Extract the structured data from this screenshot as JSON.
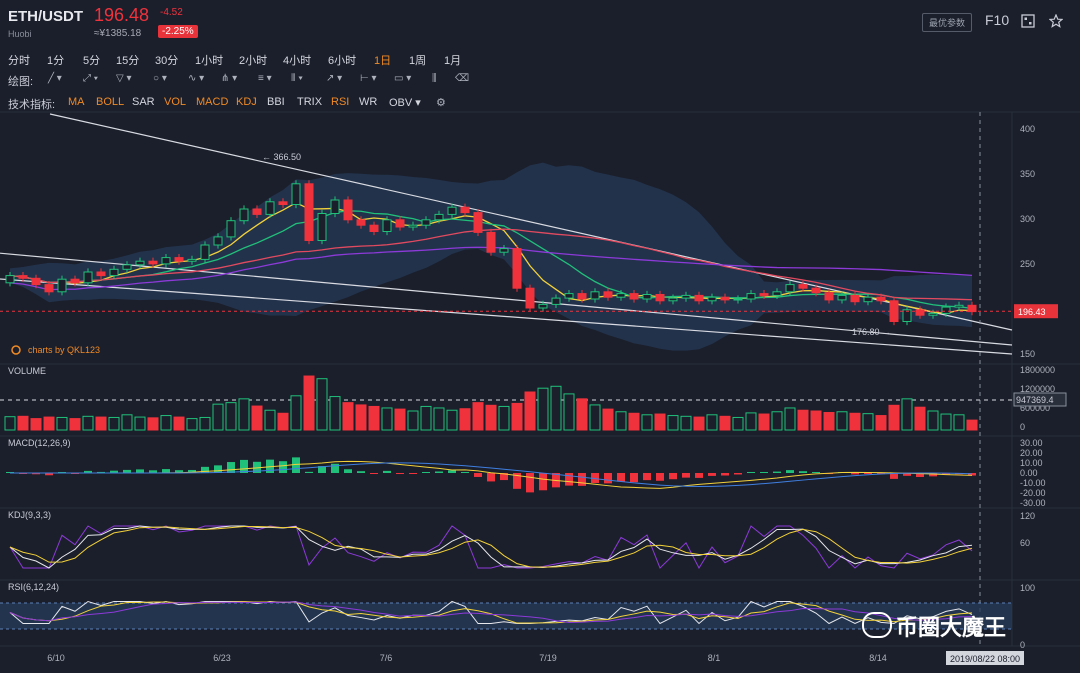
{
  "header": {
    "pair": "ETH/USDT",
    "exchange": "Huobi",
    "price": "196.48",
    "price_cny": "≈¥1385.18",
    "change": "-4.52",
    "change_pct": "-2.25%",
    "options_label": "最优参数",
    "f10_label": "F10",
    "price_color": "#f0323c"
  },
  "timeframes": [
    "分时",
    "1分",
    "5分",
    "15分",
    "30分",
    "1小时",
    "2小时",
    "4小时",
    "6小时",
    "1日",
    "1周",
    "1月"
  ],
  "active_timeframe": "1日",
  "drawing": {
    "label": "绘图:",
    "tools": [
      "line-tool-icon",
      "ray-tool-icon",
      "triangle-tool-icon",
      "circle-tool-icon",
      "wave-tool-icon",
      "pitchfork-tool-icon",
      "hlines-tool-icon",
      "vlines-tool-icon",
      "arrow-tool-icon",
      "measure-tool-icon",
      "comment-tool-icon",
      "bars-tool-icon",
      "trash-icon"
    ]
  },
  "indicators": {
    "label": "技术指标:",
    "items": [
      "MA",
      "BOLL",
      "SAR",
      "VOL",
      "MACD",
      "KDJ",
      "BBI",
      "TRIX",
      "RSI",
      "WR",
      "OBV ▾"
    ],
    "active": [
      "MA",
      "BOLL",
      "VOL",
      "MACD",
      "KDJ",
      "RSI"
    ],
    "accent": "#f08a24"
  },
  "chart_data": {
    "type": "candlestick",
    "y_ticks": [
      "400",
      "350",
      "300",
      "250",
      "200",
      "150"
    ],
    "x_ticks": [
      "6/10",
      "6/23",
      "7/6",
      "7/19",
      "8/1",
      "8/14"
    ],
    "high_label": "366.50",
    "low_label": "176.80",
    "last_price_label": "196.43",
    "cursor_date": "2019/08/22 08:00",
    "brand_label": "charts by QKL123",
    "candles": [
      [
        228,
        236
      ],
      [
        236,
        233
      ],
      [
        233,
        226
      ],
      [
        226,
        218
      ],
      [
        218,
        232
      ],
      [
        232,
        228
      ],
      [
        228,
        240
      ],
      [
        240,
        236
      ],
      [
        236,
        243
      ],
      [
        243,
        248
      ],
      [
        248,
        252
      ],
      [
        252,
        249
      ],
      [
        249,
        256
      ],
      [
        256,
        252
      ],
      [
        252,
        254
      ],
      [
        254,
        270
      ],
      [
        270,
        279
      ],
      [
        279,
        297
      ],
      [
        297,
        310
      ],
      [
        310,
        304
      ],
      [
        304,
        318
      ],
      [
        318,
        315
      ],
      [
        315,
        338
      ],
      [
        338,
        275
      ],
      [
        275,
        305
      ],
      [
        305,
        320
      ],
      [
        320,
        298
      ],
      [
        298,
        292
      ],
      [
        292,
        285
      ],
      [
        285,
        298
      ],
      [
        298,
        290
      ],
      [
        290,
        292
      ],
      [
        292,
        298
      ],
      [
        298,
        304
      ],
      [
        304,
        312
      ],
      [
        312,
        306
      ],
      [
        306,
        284
      ],
      [
        284,
        262
      ],
      [
        262,
        266
      ],
      [
        266,
        222
      ],
      [
        222,
        200
      ],
      [
        200,
        204
      ],
      [
        204,
        211
      ],
      [
        211,
        216
      ],
      [
        216,
        210
      ],
      [
        210,
        218
      ],
      [
        218,
        212
      ],
      [
        212,
        216
      ],
      [
        216,
        210
      ],
      [
        210,
        215
      ],
      [
        215,
        208
      ],
      [
        208,
        211
      ],
      [
        211,
        214
      ],
      [
        214,
        208
      ],
      [
        208,
        212
      ],
      [
        212,
        209
      ],
      [
        209,
        210
      ],
      [
        210,
        216
      ],
      [
        216,
        214
      ],
      [
        214,
        218
      ],
      [
        218,
        226
      ],
      [
        226,
        222
      ],
      [
        222,
        217
      ],
      [
        217,
        209
      ],
      [
        209,
        214
      ],
      [
        214,
        207
      ],
      [
        207,
        212
      ],
      [
        212,
        208
      ],
      [
        208,
        185
      ],
      [
        185,
        198
      ],
      [
        198,
        192
      ],
      [
        192,
        194
      ],
      [
        194,
        201
      ],
      [
        201,
        203
      ],
      [
        203,
        196
      ]
    ],
    "volume_ticks": [
      "1800000",
      "1200000",
      "600000",
      "0"
    ],
    "volume_label": "VOLUME",
    "volume_marker": "947369.4",
    "volume": [
      0.35,
      0.36,
      0.3,
      0.34,
      0.33,
      0.3,
      0.36,
      0.34,
      0.33,
      0.4,
      0.34,
      0.32,
      0.38,
      0.34,
      0.3,
      0.33,
      0.68,
      0.72,
      0.82,
      0.63,
      0.52,
      0.44,
      0.9,
      1.42,
      1.35,
      0.88,
      0.72,
      0.66,
      0.62,
      0.58,
      0.55,
      0.5,
      0.62,
      0.58,
      0.52,
      0.56,
      0.72,
      0.65,
      0.62,
      0.7,
      1.0,
      1.1,
      1.15,
      0.95,
      0.82,
      0.66,
      0.55,
      0.48,
      0.44,
      0.4,
      0.42,
      0.38,
      0.36,
      0.34,
      0.4,
      0.36,
      0.33,
      0.45,
      0.42,
      0.48,
      0.58,
      0.52,
      0.5,
      0.46,
      0.48,
      0.44,
      0.43,
      0.38,
      0.65,
      0.82,
      0.6,
      0.5,
      0.42,
      0.4,
      0.26
    ],
    "macd_label": "MACD(12,26,9)",
    "macd_ticks": [
      "30.00",
      "20.00",
      "10.00",
      "0.00",
      "-10.00",
      "-20.00",
      "-30.00"
    ],
    "kdj_label": "KDJ(9,3,3)",
    "kdj_ticks": [
      "120",
      "60"
    ],
    "rsi_label": "RSI(6,12,24)",
    "rsi_ticks": [
      "100",
      "0"
    ]
  },
  "watermark": "币圈大魔王"
}
